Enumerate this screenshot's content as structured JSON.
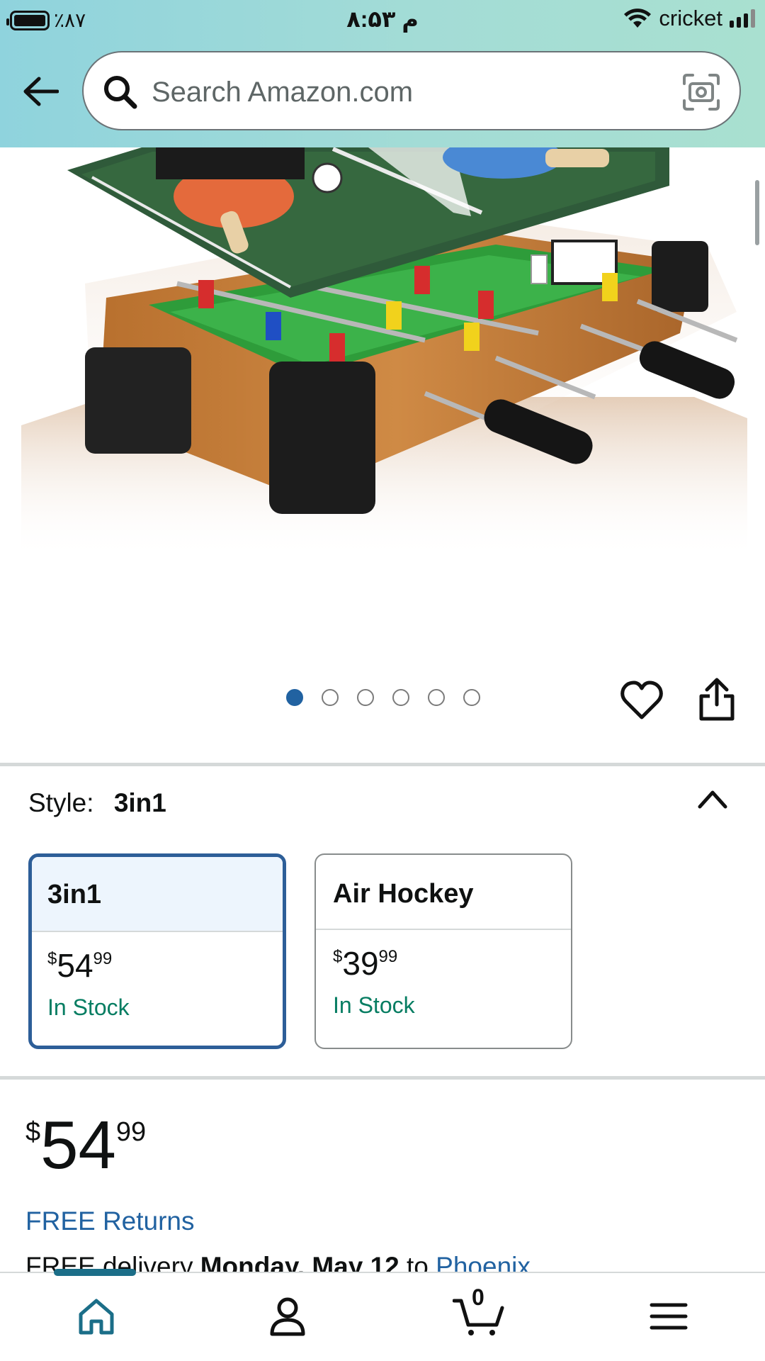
{
  "status_bar": {
    "battery_text": "٪۸۷",
    "time": "۸:۵۳ م",
    "carrier": "cricket"
  },
  "search": {
    "placeholder": "Search Amazon.com"
  },
  "gallery": {
    "image_alt": "3-in-1 tabletop foosball table with ping pong top",
    "dot_count": 6,
    "active_index": 0
  },
  "style": {
    "label": "Style:",
    "selected": "3in1",
    "options": [
      {
        "name": "3in1",
        "price_symbol": "$",
        "price_whole": "54",
        "price_fraction": "99",
        "availability": "In Stock"
      },
      {
        "name": "Air Hockey",
        "price_symbol": "$",
        "price_whole": "39",
        "price_fraction": "99",
        "availability": "In Stock"
      }
    ]
  },
  "price": {
    "symbol": "$",
    "whole": "54",
    "fraction": "99"
  },
  "returns_text": "FREE Returns",
  "delivery": {
    "prefix": "FREE delivery",
    "date": "Monday, May 12",
    "to": "to",
    "location": "Phoenix"
  },
  "cart": {
    "count": "0"
  },
  "colors": {
    "link": "#2162a1",
    "in_stock": "#067d62",
    "selected_border": "#2d5e98",
    "header_gradient": "#8fd3dd"
  }
}
